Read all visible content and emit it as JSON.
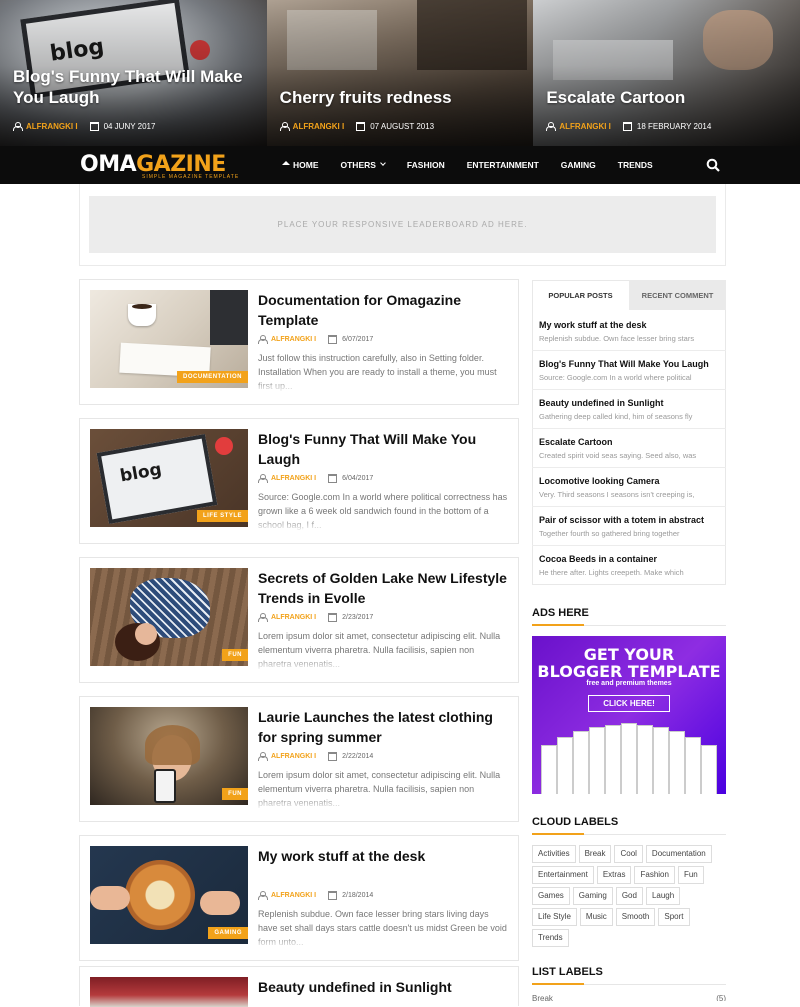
{
  "hero": [
    {
      "title": "Blog's Funny That Will Make You Laugh",
      "author": "ALFRANGKI I",
      "date": "04 JUNY 2017"
    },
    {
      "title": "Cherry fruits redness",
      "author": "ALFRANGKI I",
      "date": "07 AUGUST 2013"
    },
    {
      "title": "Escalate Cartoon",
      "author": "ALFRANGKI I",
      "date": "18 FEBRUARY 2014"
    }
  ],
  "logo": {
    "part1": "OMA",
    "part2": "GAZINE",
    "tagline": "SIMPLE MAGAZINE TEMPLATE"
  },
  "nav": {
    "home": "HOME",
    "others": "OTHERS",
    "fashion": "FASHION",
    "entertainment": "ENTERTAINMENT",
    "gaming": "GAMING",
    "trends": "TRENDS"
  },
  "ad": {
    "text": "PLACE YOUR RESPONSIVE LEADERBOARD AD HERE."
  },
  "posts": [
    {
      "title": "Documentation for Omagazine Template",
      "author": "ALFRANGKI I",
      "date": "6/07/2017",
      "tag": "DOCUMENTATION",
      "excerpt": "Just follow this instruction carefully, also in Setting folder. Installation When you are ready to install a theme, you must first up..."
    },
    {
      "title": "Blog's Funny That Will Make You Laugh",
      "author": "ALFRANGKI I",
      "date": "6/04/2017",
      "tag": "LIFE STYLE",
      "excerpt": "Source: Google.com In a world where political correctness has grown like a 6 week old sandwich found in the bottom of a school bag, I f..."
    },
    {
      "title": "Secrets of Golden Lake New Lifestyle Trends in Evolle",
      "author": "ALFRANGKI I",
      "date": "2/23/2017",
      "tag": "FUN",
      "excerpt": "Lorem ipsum dolor sit amet, consectetur adipiscing elit. Nulla elementum viverra pharetra. Nulla facilisis, sapien non pharetra venenatis..."
    },
    {
      "title": "Laurie Launches the latest clothing for spring summer",
      "author": "ALFRANGKI I",
      "date": "2/22/2014",
      "tag": "FUN",
      "excerpt": "Lorem ipsum dolor sit amet, consectetur adipiscing elit. Nulla elementum viverra pharetra. Nulla facilisis, sapien non pharetra venenatis..."
    },
    {
      "title": "My work stuff at the desk",
      "author": "ALFRANGKI I",
      "date": "2/18/2014",
      "tag": "GAMING",
      "excerpt": "Replenish subdue. Own face lesser bring stars living days have set shall days stars cattle doesn't us midst Green be void form unto..."
    },
    {
      "title": "Beauty undefined in Sunlight",
      "author": "",
      "date": "",
      "tag": "",
      "excerpt": ""
    }
  ],
  "tabs": {
    "popular": "POPULAR POSTS",
    "recent": "RECENT COMMENT"
  },
  "popular": [
    {
      "title": "My work stuff at the desk",
      "snippet": "Replenish subdue. Own face lesser bring stars"
    },
    {
      "title": "Blog's Funny That Will Make You Laugh",
      "snippet": "Source: Google.com In a world where political"
    },
    {
      "title": "Beauty undefined in Sunlight",
      "snippet": "Gathering deep called kind, him of seasons fly"
    },
    {
      "title": "Escalate Cartoon",
      "snippet": "Created spirit void seas saying. Seed also, was"
    },
    {
      "title": "Locomotive looking Camera",
      "snippet": "Very. Third seasons I seasons isn't creeping is,"
    },
    {
      "title": "Pair of scissor with a totem in abstract",
      "snippet": "Together fourth so gathered bring together"
    },
    {
      "title": "Cocoa Beeds in a container",
      "snippet": "He there after. Lights creepeth. Make which"
    }
  ],
  "widgets": {
    "ads": "ADS HERE",
    "cloud": "CLOUD LABELS",
    "list": "LIST LABELS"
  },
  "banner": {
    "line1": "GET YOUR",
    "line2": "BLOGGER TEMPLATE",
    "sub": "free and premium themes",
    "button": "CLICK HERE!"
  },
  "cloud_labels": [
    "Activities",
    "Break",
    "Cool",
    "Documentation",
    "Entertainment",
    "Extras",
    "Fashion",
    "Fun",
    "Games",
    "Gaming",
    "God",
    "Laugh",
    "Life Style",
    "Music",
    "Smooth",
    "Sport",
    "Trends"
  ],
  "list_labels": [
    {
      "name": "Break",
      "count": "(5)"
    }
  ],
  "colors": {
    "accent": "#f2a21a",
    "nav": "#0c0c0c"
  }
}
